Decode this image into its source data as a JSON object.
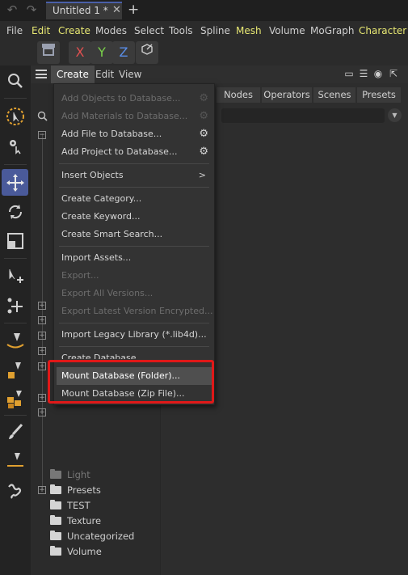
{
  "titlebar": {
    "undo_icon": "undo-icon",
    "redo_icon": "redo-icon",
    "document_tab": "Untitled 1 *",
    "close_glyph": "✕",
    "new_tab_glyph": "+"
  },
  "menubar": {
    "items": [
      "File",
      "Edit",
      "Create",
      "Modes",
      "Select",
      "Tools",
      "Spline",
      "Mesh",
      "Volume",
      "MoGraph",
      "Character"
    ],
    "highlighted_color": "#e8e873"
  },
  "axis_toolbar": {
    "x": {
      "label": "X",
      "color": "#e05050"
    },
    "y": {
      "label": "Y",
      "color": "#7ad04a"
    },
    "z": {
      "label": "Z",
      "color": "#5a8ee8"
    }
  },
  "left_tools": [
    "magnifier-icon",
    "live-selection-icon",
    "selection-gear-icon",
    "move-icon",
    "rotate-icon",
    "scale-icon",
    "move-arrows-icon",
    "scatter-move-icon",
    "spline-pen-icon",
    "point-icon",
    "cubes-icon",
    "brush-icon",
    "spline-line-icon",
    "spline-draw-icon"
  ],
  "asset_browser": {
    "menu": [
      "Create",
      "Edit",
      "View"
    ],
    "open_menu": "Create",
    "tabs": [
      "Nodes",
      "Operators",
      "Scenes",
      "Presets"
    ],
    "search_placeholder": "",
    "tree_folders_visible": [
      "Light",
      "Presets",
      "TEST",
      "Texture",
      "Uncategorized",
      "Volume"
    ]
  },
  "create_menu": {
    "items": [
      {
        "label": "Add Objects to Database...",
        "disabled": true,
        "gear": true
      },
      {
        "label": "Add Materials to Database...",
        "disabled": true,
        "gear": true
      },
      {
        "label": "Add File to Database...",
        "disabled": false,
        "gear": true
      },
      {
        "label": "Add Project to Database...",
        "disabled": false,
        "gear": true
      },
      {
        "label": "Insert Objects",
        "disabled": false,
        "submenu": true
      },
      {
        "label": "Create Category...",
        "disabled": false
      },
      {
        "label": "Create Keyword...",
        "disabled": false
      },
      {
        "label": "Create Smart Search...",
        "disabled": false
      },
      {
        "label": "Import Assets...",
        "disabled": false
      },
      {
        "label": "Export...",
        "disabled": true
      },
      {
        "label": "Export All Versions...",
        "disabled": true
      },
      {
        "label": "Export Latest Version Encrypted...",
        "disabled": true
      },
      {
        "label": "Import Legacy Library (*.lib4d)...",
        "disabled": false
      },
      {
        "label": "Create Database...",
        "disabled": false
      },
      {
        "label": "Mount Database (Folder)...",
        "disabled": false,
        "hover": true
      },
      {
        "label": "Mount Database (Zip File)...",
        "disabled": false
      }
    ],
    "submenu_glyph": ">",
    "highlight_color": "#e01818"
  }
}
